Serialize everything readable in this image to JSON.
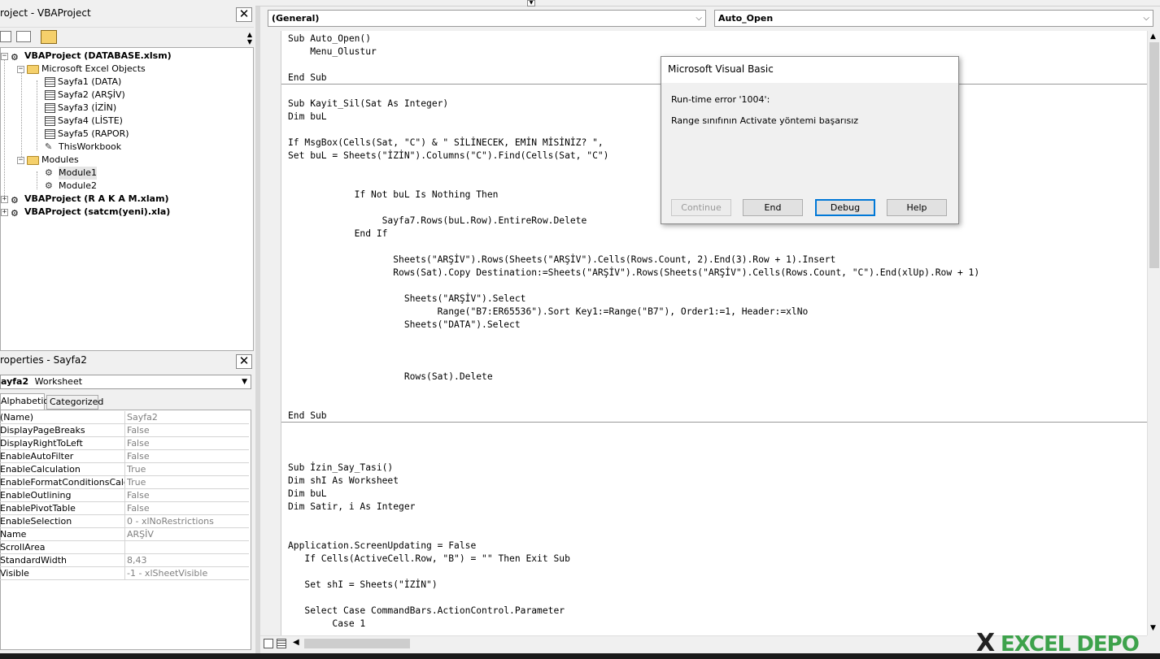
{
  "project_panel": {
    "title": "roject - VBAProject",
    "tree": [
      {
        "label": "VBAProject (DATABASE.xlsm)",
        "bold": true
      },
      {
        "label": "Microsoft Excel Objects"
      },
      {
        "label": "Sayfa1 (DATA)"
      },
      {
        "label": "Sayfa2 (ARŞİV)"
      },
      {
        "label": "Sayfa3 (İZİN)"
      },
      {
        "label": "Sayfa4 (LİSTE)"
      },
      {
        "label": "Sayfa5 (RAPOR)"
      },
      {
        "label": "ThisWorkbook"
      },
      {
        "label": "Modules"
      },
      {
        "label": "Module1"
      },
      {
        "label": "Module2"
      },
      {
        "label": "VBAProject (R A K A M.xlam)",
        "bold": true
      },
      {
        "label": "VBAProject (satcm(yeni).xla)",
        "bold": true
      }
    ]
  },
  "properties_panel": {
    "title": "roperties - Sayfa2",
    "object_name": "ayfa2",
    "object_type": "Worksheet",
    "tabs": [
      "Alphabetic",
      "Categorized"
    ],
    "rows": [
      {
        "name": "(Name)",
        "value": "Sayfa2"
      },
      {
        "name": "DisplayPageBreaks",
        "value": "False"
      },
      {
        "name": "DisplayRightToLeft",
        "value": "False"
      },
      {
        "name": "EnableAutoFilter",
        "value": "False"
      },
      {
        "name": "EnableCalculation",
        "value": "True"
      },
      {
        "name": "EnableFormatConditionsCalculati",
        "value": "True"
      },
      {
        "name": "EnableOutlining",
        "value": "False"
      },
      {
        "name": "EnablePivotTable",
        "value": "False"
      },
      {
        "name": "EnableSelection",
        "value": "0 - xlNoRestrictions"
      },
      {
        "name": "Name",
        "value": "ARŞİV"
      },
      {
        "name": "ScrollArea",
        "value": ""
      },
      {
        "name": "StandardWidth",
        "value": "8,43"
      },
      {
        "name": "Visible",
        "value": "-1 - xlSheetVisible"
      }
    ]
  },
  "code_window": {
    "object_combo": "(General)",
    "proc_combo": "Auto_Open",
    "lines": [
      "Sub Auto_Open()",
      "    Menu_Olustur",
      "",
      "End Sub",
      "",
      "Sub Kayit_Sil(Sat As Integer)",
      "Dim buL",
      "",
      "If MsgBox(Cells(Sat, \"C\") & \" SİLİNECEK, EMİN MİSİNİZ? \",",
      "Set buL = Sheets(\"İZİN\").Columns(\"C\").Find(Cells(Sat, \"C\")",
      "",
      "",
      "            If Not buL Is Nothing Then",
      "",
      "                 Sayfa7.Rows(buL.Row).EntireRow.Delete",
      "            End If",
      "",
      "                   Sheets(\"ARŞİV\").Rows(Sheets(\"ARŞİV\").Cells(Rows.Count, 2).End(3).Row + 1).Insert",
      "                   Rows(Sat).Copy Destination:=Sheets(\"ARŞİV\").Rows(Sheets(\"ARŞİV\").Cells(Rows.Count, \"C\").End(xlUp).Row + 1)",
      "",
      "                     Sheets(\"ARŞİV\").Select",
      "                           Range(\"B7:ER65536\").Sort Key1:=Range(\"B7\"), Order1:=1, Header:=xlNo",
      "                     Sheets(\"DATA\").Select",
      "",
      "",
      "",
      "                     Rows(Sat).Delete",
      "",
      "",
      "End Sub",
      "",
      "",
      "",
      "Sub İzin_Say_Tasi()",
      "Dim shI As Worksheet",
      "Dim buL",
      "Dim Satir, i As Integer",
      "",
      "",
      "Application.ScreenUpdating = False",
      "   If Cells(ActiveCell.Row, \"B\") = \"\" Then Exit Sub",
      "",
      "   Set shI = Sheets(\"İZİN\")",
      "",
      "   Select Case CommandBars.ActionControl.Parameter",
      "        Case 1"
    ]
  },
  "dialog": {
    "title": "Microsoft Visual Basic",
    "error_line": "Run-time error '1004':",
    "message": "Range sınıfının Activate yöntemi başarısız",
    "buttons": {
      "continue": "Continue",
      "end": "End",
      "debug": "Debug",
      "help": "Help"
    }
  },
  "watermark": "EXCEL DEPO"
}
